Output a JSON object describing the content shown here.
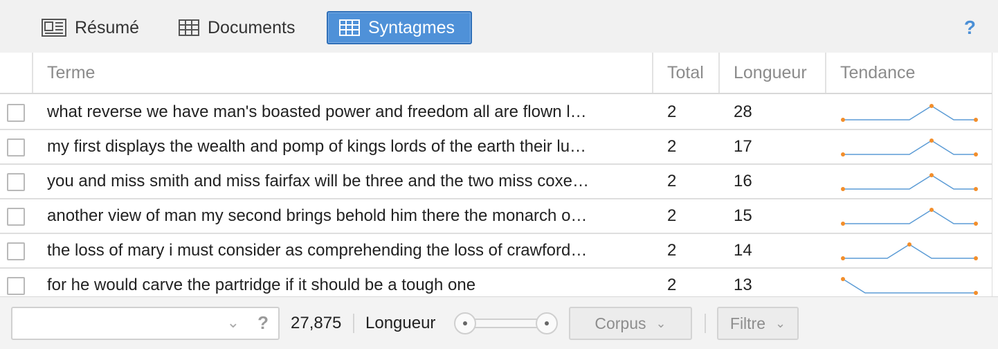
{
  "tabs": [
    {
      "label": "Résumé",
      "icon": "summary-icon",
      "active": false
    },
    {
      "label": "Documents",
      "icon": "table-icon",
      "active": false
    },
    {
      "label": "Syntagmes",
      "icon": "table-icon",
      "active": true
    }
  ],
  "help_label": "?",
  "columns": {
    "term": "Terme",
    "total": "Total",
    "length": "Longueur",
    "trend": "Tendance"
  },
  "rows": [
    {
      "term": "what reverse we have man's boasted power and freedom all are flown l…",
      "total": "2",
      "length": "28",
      "trend": [
        0,
        0,
        0,
        0,
        1,
        0,
        0
      ]
    },
    {
      "term": "my first displays the wealth and pomp of kings lords of the earth their lu…",
      "total": "2",
      "length": "17",
      "trend": [
        0,
        0,
        0,
        0,
        1,
        0,
        0
      ]
    },
    {
      "term": "you and miss smith and miss fairfax will be three and the two miss coxe…",
      "total": "2",
      "length": "16",
      "trend": [
        0,
        0,
        0,
        0,
        1,
        0,
        0
      ]
    },
    {
      "term": "another view of man my second brings behold him there the monarch o…",
      "total": "2",
      "length": "15",
      "trend": [
        0,
        0,
        0,
        0,
        1,
        0,
        0
      ]
    },
    {
      "term": "the loss of mary i must consider as comprehending the loss of crawford…",
      "total": "2",
      "length": "14",
      "trend": [
        0,
        0,
        0,
        1,
        0,
        0,
        0
      ]
    },
    {
      "term": "for he would carve the partridge if it should be a tough one",
      "total": "2",
      "length": "13",
      "trend": [
        1,
        0,
        0,
        0,
        0,
        0,
        0
      ]
    }
  ],
  "footer": {
    "search_value": "",
    "help_label": "?",
    "count": "27,875",
    "length_label": "Longueur",
    "corpus_label": "Corpus",
    "filter_label": "Filtre"
  },
  "colors": {
    "accent": "#4f91d8",
    "spark_line": "#5b9bd5",
    "spark_dot": "#f28e2b"
  }
}
